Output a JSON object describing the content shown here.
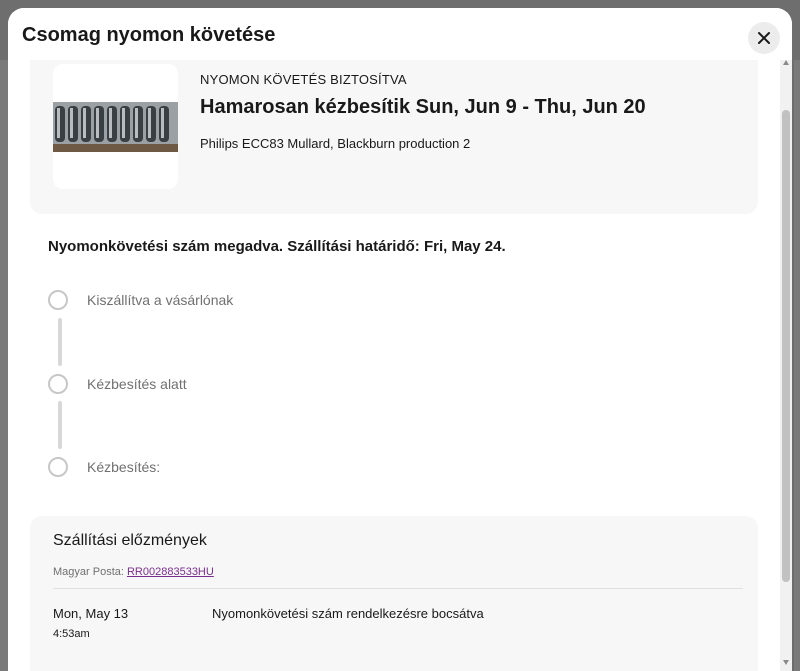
{
  "modal": {
    "title": "Csomag nyomon követése",
    "close_label": "×"
  },
  "item": {
    "status_caption": "NYOMON KÖVETÉS BIZTOSÍTVA",
    "delivery_estimate": "Hamarosan kézbesítik Sun, Jun 9 - Thu, Jun 20",
    "title": "Philips ECC83 Mullard, Blackburn production 2",
    "image": "vacuum-tubes-photo"
  },
  "tracking_info": "Nyomonkövetési szám megadva. Szállítási határidő: Fri, May 24.",
  "steps": [
    {
      "label": "Kiszállítva a vásárlónak"
    },
    {
      "label": "Kézbesítés alatt"
    },
    {
      "label": "Kézbesítés:"
    }
  ],
  "history": {
    "title": "Szállítási előzmények",
    "carrier_name": "Magyar Posta:",
    "tracking_number": "RR002883533HU",
    "events": [
      {
        "date": "Mon, May 13",
        "time": "4:53am",
        "description": "Nyomonkövetési szám rendelkezésre bocsátva"
      }
    ]
  },
  "colors": {
    "accent_link": "#7a2f8c",
    "card_bg": "#f7f7f7",
    "overlay": "#6e6e6e"
  }
}
